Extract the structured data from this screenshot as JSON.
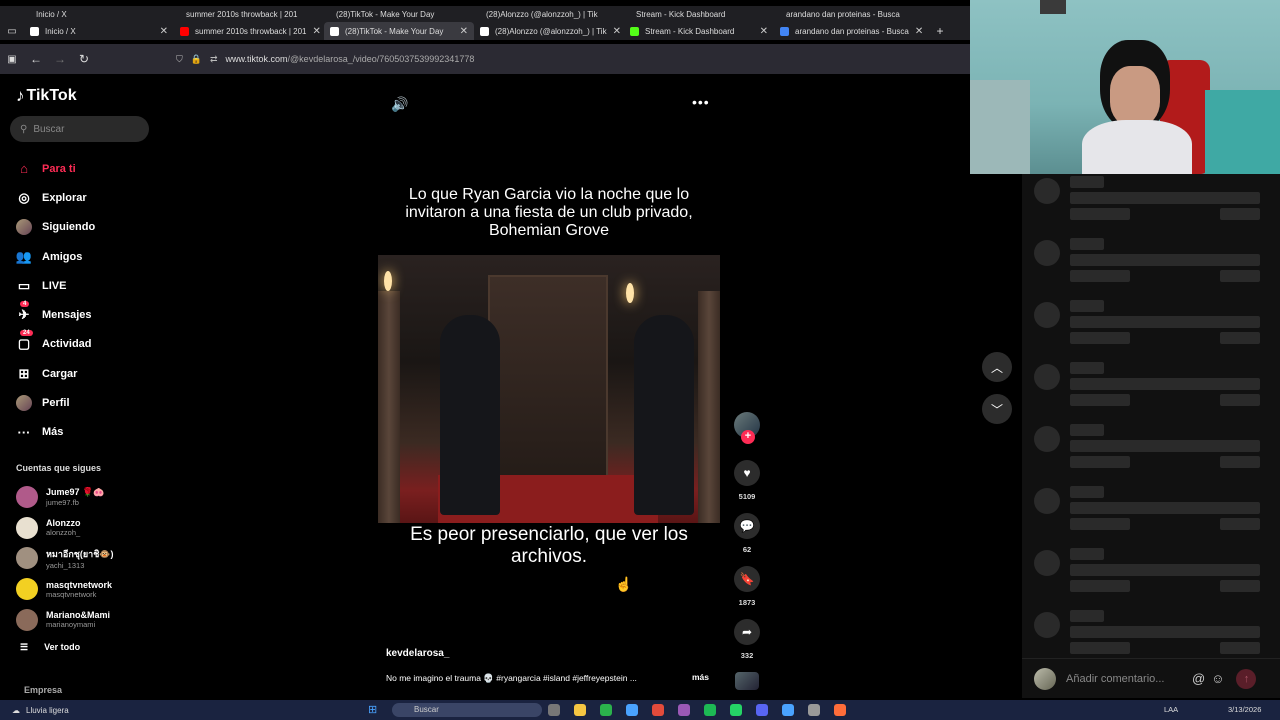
{
  "browser": {
    "tabs": [
      {
        "label": "Inicio / X",
        "icon": "x-logo-icon",
        "color": "#ffffff"
      },
      {
        "label": "summer 2010s throwback | 201",
        "icon": "youtube-icon",
        "color": "#ff0000"
      },
      {
        "label": "(28)TikTok - Make Your Day",
        "icon": "tiktok-icon",
        "color": "#ffffff",
        "active": true
      },
      {
        "label": "(28)Alonzzo (@alonzzoh_) | Tik",
        "icon": "tiktok-icon",
        "color": "#ffffff"
      },
      {
        "label": "Stream - Kick Dashboard",
        "icon": "kick-icon",
        "color": "#53fc18"
      },
      {
        "label": "arandano dan proteinas - Busca",
        "icon": "google-icon",
        "color": "#4285f4"
      }
    ],
    "ghost_tabs": [
      "Inicio / X",
      "summer 2010s throwback | 201",
      "(28)TikTok - Make Your Day",
      "(28)Alonzzo (@alonzzoh_) | Tik",
      "Stream - Kick Dashboard",
      "arandano dan proteinas - Busca"
    ],
    "url_domain": "www.tiktok.com",
    "url_path": "/@kevdelarosa_/video/7605037539992341778"
  },
  "sidebar": {
    "logo": "TikTok",
    "search_placeholder": "Buscar",
    "nav": [
      {
        "label": "Para ti",
        "icon": "home-icon",
        "active": true
      },
      {
        "label": "Explorar",
        "icon": "compass-icon"
      },
      {
        "label": "Siguiendo",
        "icon": "avatar-icon"
      },
      {
        "label": "Amigos",
        "icon": "friends-icon"
      },
      {
        "label": "LIVE",
        "icon": "live-icon"
      },
      {
        "label": "Mensajes",
        "icon": "messages-icon",
        "badge": "4"
      },
      {
        "label": "Actividad",
        "icon": "activity-icon",
        "badge": "24"
      },
      {
        "label": "Cargar",
        "icon": "upload-icon"
      },
      {
        "label": "Perfil",
        "icon": "profile-icon"
      },
      {
        "label": "Más",
        "icon": "more-icon"
      }
    ],
    "following_title": "Cuentas que sigues",
    "following": [
      {
        "name": "Jume97 🌹🐽",
        "handle": "jume97.fb",
        "color": "#b05a8a"
      },
      {
        "name": "Alonzzo",
        "handle": "alonzzoh_",
        "color": "#e8e0d0"
      },
      {
        "name": "หมาอีกชุ(ยาชิ🐵)",
        "handle": "yachi_1313",
        "color": "#a09080"
      },
      {
        "name": "masqtvnetwork",
        "handle": "masqtvnetwork",
        "color": "#f2d022"
      },
      {
        "name": "Mariano&Mami",
        "handle": "marianoymami",
        "color": "#8a6a5a"
      }
    ],
    "see_all": "Ver todo",
    "company": "Empresa"
  },
  "video": {
    "caption_top": "Lo que Ryan Garcia vio la noche que lo invitaron a una fiesta de un club privado, Bohemian Grove",
    "caption_bottom": "Es peor presenciarlo, que ver los archivos.",
    "author": "kevdelarosa_",
    "description": "No me imagino el trauma 💀 #ryangarcia #island #jeffreyepstein ...",
    "more_label": "más",
    "likes": "5109",
    "comments": "62",
    "saves": "1873",
    "shares": "332"
  },
  "comments_panel": {
    "placeholder": "Añadir comentario..."
  },
  "taskbar": {
    "weather": "Lluvia ligera",
    "search_placeholder": "Buscar",
    "language": "LAA",
    "date": "3/13/2026"
  }
}
